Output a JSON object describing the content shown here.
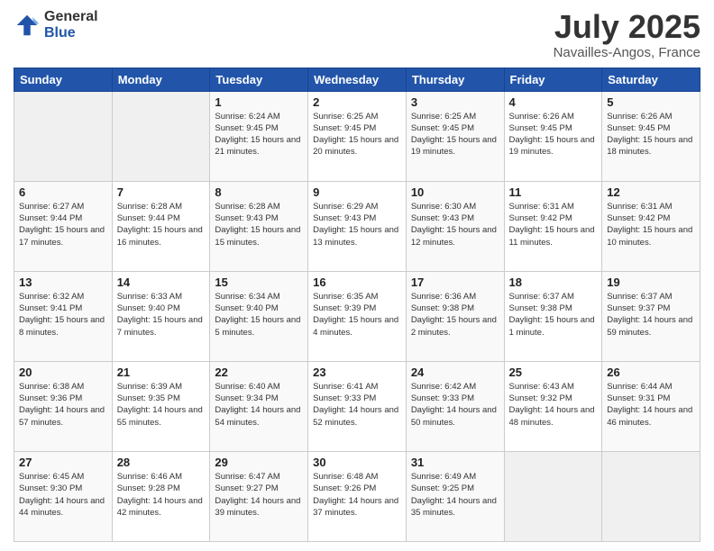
{
  "logo": {
    "general": "General",
    "blue": "Blue"
  },
  "title": "July 2025",
  "subtitle": "Navailles-Angos, France",
  "header_days": [
    "Sunday",
    "Monday",
    "Tuesday",
    "Wednesday",
    "Thursday",
    "Friday",
    "Saturday"
  ],
  "weeks": [
    [
      {
        "day": "",
        "sunrise": "",
        "sunset": "",
        "daylight": ""
      },
      {
        "day": "",
        "sunrise": "",
        "sunset": "",
        "daylight": ""
      },
      {
        "day": "1",
        "sunrise": "Sunrise: 6:24 AM",
        "sunset": "Sunset: 9:45 PM",
        "daylight": "Daylight: 15 hours and 21 minutes."
      },
      {
        "day": "2",
        "sunrise": "Sunrise: 6:25 AM",
        "sunset": "Sunset: 9:45 PM",
        "daylight": "Daylight: 15 hours and 20 minutes."
      },
      {
        "day": "3",
        "sunrise": "Sunrise: 6:25 AM",
        "sunset": "Sunset: 9:45 PM",
        "daylight": "Daylight: 15 hours and 19 minutes."
      },
      {
        "day": "4",
        "sunrise": "Sunrise: 6:26 AM",
        "sunset": "Sunset: 9:45 PM",
        "daylight": "Daylight: 15 hours and 19 minutes."
      },
      {
        "day": "5",
        "sunrise": "Sunrise: 6:26 AM",
        "sunset": "Sunset: 9:45 PM",
        "daylight": "Daylight: 15 hours and 18 minutes."
      }
    ],
    [
      {
        "day": "6",
        "sunrise": "Sunrise: 6:27 AM",
        "sunset": "Sunset: 9:44 PM",
        "daylight": "Daylight: 15 hours and 17 minutes."
      },
      {
        "day": "7",
        "sunrise": "Sunrise: 6:28 AM",
        "sunset": "Sunset: 9:44 PM",
        "daylight": "Daylight: 15 hours and 16 minutes."
      },
      {
        "day": "8",
        "sunrise": "Sunrise: 6:28 AM",
        "sunset": "Sunset: 9:43 PM",
        "daylight": "Daylight: 15 hours and 15 minutes."
      },
      {
        "day": "9",
        "sunrise": "Sunrise: 6:29 AM",
        "sunset": "Sunset: 9:43 PM",
        "daylight": "Daylight: 15 hours and 13 minutes."
      },
      {
        "day": "10",
        "sunrise": "Sunrise: 6:30 AM",
        "sunset": "Sunset: 9:43 PM",
        "daylight": "Daylight: 15 hours and 12 minutes."
      },
      {
        "day": "11",
        "sunrise": "Sunrise: 6:31 AM",
        "sunset": "Sunset: 9:42 PM",
        "daylight": "Daylight: 15 hours and 11 minutes."
      },
      {
        "day": "12",
        "sunrise": "Sunrise: 6:31 AM",
        "sunset": "Sunset: 9:42 PM",
        "daylight": "Daylight: 15 hours and 10 minutes."
      }
    ],
    [
      {
        "day": "13",
        "sunrise": "Sunrise: 6:32 AM",
        "sunset": "Sunset: 9:41 PM",
        "daylight": "Daylight: 15 hours and 8 minutes."
      },
      {
        "day": "14",
        "sunrise": "Sunrise: 6:33 AM",
        "sunset": "Sunset: 9:40 PM",
        "daylight": "Daylight: 15 hours and 7 minutes."
      },
      {
        "day": "15",
        "sunrise": "Sunrise: 6:34 AM",
        "sunset": "Sunset: 9:40 PM",
        "daylight": "Daylight: 15 hours and 5 minutes."
      },
      {
        "day": "16",
        "sunrise": "Sunrise: 6:35 AM",
        "sunset": "Sunset: 9:39 PM",
        "daylight": "Daylight: 15 hours and 4 minutes."
      },
      {
        "day": "17",
        "sunrise": "Sunrise: 6:36 AM",
        "sunset": "Sunset: 9:38 PM",
        "daylight": "Daylight: 15 hours and 2 minutes."
      },
      {
        "day": "18",
        "sunrise": "Sunrise: 6:37 AM",
        "sunset": "Sunset: 9:38 PM",
        "daylight": "Daylight: 15 hours and 1 minute."
      },
      {
        "day": "19",
        "sunrise": "Sunrise: 6:37 AM",
        "sunset": "Sunset: 9:37 PM",
        "daylight": "Daylight: 14 hours and 59 minutes."
      }
    ],
    [
      {
        "day": "20",
        "sunrise": "Sunrise: 6:38 AM",
        "sunset": "Sunset: 9:36 PM",
        "daylight": "Daylight: 14 hours and 57 minutes."
      },
      {
        "day": "21",
        "sunrise": "Sunrise: 6:39 AM",
        "sunset": "Sunset: 9:35 PM",
        "daylight": "Daylight: 14 hours and 55 minutes."
      },
      {
        "day": "22",
        "sunrise": "Sunrise: 6:40 AM",
        "sunset": "Sunset: 9:34 PM",
        "daylight": "Daylight: 14 hours and 54 minutes."
      },
      {
        "day": "23",
        "sunrise": "Sunrise: 6:41 AM",
        "sunset": "Sunset: 9:33 PM",
        "daylight": "Daylight: 14 hours and 52 minutes."
      },
      {
        "day": "24",
        "sunrise": "Sunrise: 6:42 AM",
        "sunset": "Sunset: 9:33 PM",
        "daylight": "Daylight: 14 hours and 50 minutes."
      },
      {
        "day": "25",
        "sunrise": "Sunrise: 6:43 AM",
        "sunset": "Sunset: 9:32 PM",
        "daylight": "Daylight: 14 hours and 48 minutes."
      },
      {
        "day": "26",
        "sunrise": "Sunrise: 6:44 AM",
        "sunset": "Sunset: 9:31 PM",
        "daylight": "Daylight: 14 hours and 46 minutes."
      }
    ],
    [
      {
        "day": "27",
        "sunrise": "Sunrise: 6:45 AM",
        "sunset": "Sunset: 9:30 PM",
        "daylight": "Daylight: 14 hours and 44 minutes."
      },
      {
        "day": "28",
        "sunrise": "Sunrise: 6:46 AM",
        "sunset": "Sunset: 9:28 PM",
        "daylight": "Daylight: 14 hours and 42 minutes."
      },
      {
        "day": "29",
        "sunrise": "Sunrise: 6:47 AM",
        "sunset": "Sunset: 9:27 PM",
        "daylight": "Daylight: 14 hours and 39 minutes."
      },
      {
        "day": "30",
        "sunrise": "Sunrise: 6:48 AM",
        "sunset": "Sunset: 9:26 PM",
        "daylight": "Daylight: 14 hours and 37 minutes."
      },
      {
        "day": "31",
        "sunrise": "Sunrise: 6:49 AM",
        "sunset": "Sunset: 9:25 PM",
        "daylight": "Daylight: 14 hours and 35 minutes."
      },
      {
        "day": "",
        "sunrise": "",
        "sunset": "",
        "daylight": ""
      },
      {
        "day": "",
        "sunrise": "",
        "sunset": "",
        "daylight": ""
      }
    ]
  ]
}
